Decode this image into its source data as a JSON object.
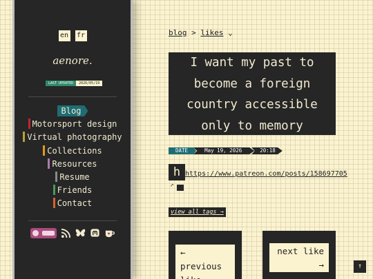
{
  "sidebar": {
    "languages": [
      "en",
      "fr"
    ],
    "logo": "aenore.",
    "last_updated_label": "LAST UPDATED",
    "last_updated_value": "2026/05/19",
    "nav": [
      {
        "label": "Blog",
        "active": true,
        "color": "#1f6d74"
      },
      {
        "label": "Motorsport design",
        "color": "#c0262b"
      },
      {
        "label": "Virtual photography",
        "color": "#b8a13a"
      },
      {
        "label": "Collections",
        "color": "#e39a1a"
      },
      {
        "label": "Resources",
        "color": "#b07ab0"
      },
      {
        "label": "Resume",
        "color": "#8a8a8a"
      },
      {
        "label": "Friends",
        "color": "#4a9a5a"
      },
      {
        "label": "Contact",
        "color": "#d5652a"
      }
    ],
    "social_icons": [
      "ko-fi-icon",
      "rss-icon",
      "bluesky-icon",
      "mastodon-icon",
      "coffee-icon"
    ]
  },
  "breadcrumb": {
    "root": "blog",
    "separator": ">",
    "current": "likes",
    "caret": "⌄"
  },
  "post": {
    "title_lines": [
      "I want my past to",
      "become a foreign",
      "country accessible",
      "only to memory"
    ],
    "date_label": "DATE",
    "date_value": "May 19, 2026",
    "time_value": "20:18",
    "icon_letter": "h",
    "url": "https://www.patreon.com/posts/158697705",
    "external_mark": "↗",
    "view_all_tags": "view all tags →"
  },
  "pager": {
    "previous_arrow": "←",
    "previous_line1": "previous",
    "previous_line2": "like",
    "next_label": "next like",
    "next_arrow": "→"
  },
  "back_to_top": "↑",
  "colors": {
    "background": "#fbf3d0",
    "dark": "#262626",
    "accent": "#1f6d74"
  }
}
